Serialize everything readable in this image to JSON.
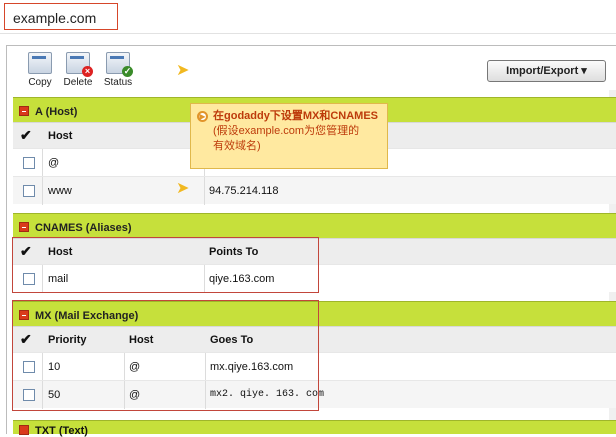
{
  "domain": "example.com",
  "toolbar": {
    "copy_label": "Copy",
    "delete_label": "Delete",
    "status_label": "Status",
    "import_export_label": "Import/Export ▾"
  },
  "a_section": {
    "title": "A (Host)",
    "col_host": "Host",
    "rows": [
      {
        "host": "@",
        "value": ""
      },
      {
        "host": "www",
        "value": "94.75.214.118"
      }
    ]
  },
  "cname_section": {
    "title": "CNAMES (Aliases)",
    "col_host": "Host",
    "col_points": "Points To",
    "rows": [
      {
        "host": "mail",
        "points_to": "qiye.163.com"
      }
    ]
  },
  "mx_section": {
    "title": "MX (Mail Exchange)",
    "col_priority": "Priority",
    "col_host": "Host",
    "col_goes": "Goes To",
    "rows": [
      {
        "priority": "10",
        "host": "@",
        "goes_to": "mx.qiye.163.com"
      },
      {
        "priority": "50",
        "host": "@",
        "goes_to": "mx2. qiye. 163. com"
      }
    ]
  },
  "txt_section": {
    "title": "TXT (Text)"
  },
  "tooltip": {
    "line1": "在godaddy下设置MX和CNAMES",
    "line2": "(假设example.com为您管理的",
    "line3": "有效域名)"
  },
  "colors": {
    "section_bar": "#c6e03b",
    "highlight_box": "#c2463b",
    "tooltip_bg": "#ffe9a0"
  }
}
